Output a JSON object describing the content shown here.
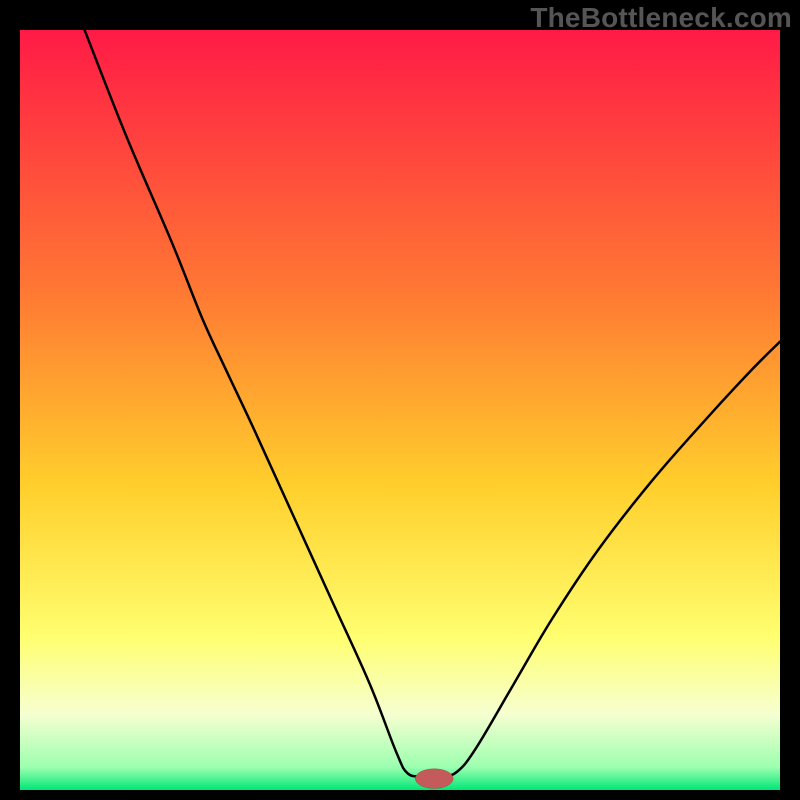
{
  "watermark": "TheBottleneck.com",
  "chart_data": {
    "type": "line",
    "title": "",
    "xlabel": "",
    "ylabel": "",
    "xlim": [
      0,
      100
    ],
    "ylim": [
      0,
      100
    ],
    "background_gradient": {
      "stops": [
        {
          "offset": 0.0,
          "color": "#ff1a46"
        },
        {
          "offset": 0.35,
          "color": "#ff7a33"
        },
        {
          "offset": 0.6,
          "color": "#ffcf2c"
        },
        {
          "offset": 0.8,
          "color": "#ffff70"
        },
        {
          "offset": 0.9,
          "color": "#f6ffd0"
        },
        {
          "offset": 0.97,
          "color": "#9cffb0"
        },
        {
          "offset": 1.0,
          "color": "#00e676"
        }
      ]
    },
    "series": [
      {
        "name": "bottleneck-curve",
        "color": "#000000",
        "width": 2.5,
        "points": [
          {
            "x": 8.5,
            "y": 100.0
          },
          {
            "x": 14.0,
            "y": 86.0
          },
          {
            "x": 20.0,
            "y": 72.0
          },
          {
            "x": 24.0,
            "y": 62.0
          },
          {
            "x": 27.0,
            "y": 55.5
          },
          {
            "x": 31.0,
            "y": 47.0
          },
          {
            "x": 36.0,
            "y": 36.0
          },
          {
            "x": 41.0,
            "y": 25.0
          },
          {
            "x": 46.0,
            "y": 14.0
          },
          {
            "x": 49.5,
            "y": 5.0
          },
          {
            "x": 51.0,
            "y": 2.2
          },
          {
            "x": 53.0,
            "y": 1.8
          },
          {
            "x": 55.5,
            "y": 1.8
          },
          {
            "x": 57.5,
            "y": 2.4
          },
          {
            "x": 60.0,
            "y": 5.5
          },
          {
            "x": 65.0,
            "y": 14.0
          },
          {
            "x": 70.0,
            "y": 22.5
          },
          {
            "x": 76.0,
            "y": 31.5
          },
          {
            "x": 83.0,
            "y": 40.5
          },
          {
            "x": 90.0,
            "y": 48.5
          },
          {
            "x": 96.0,
            "y": 55.0
          },
          {
            "x": 100.0,
            "y": 59.0
          }
        ]
      }
    ],
    "marker": {
      "name": "optimal-point",
      "cx": 54.5,
      "cy": 1.5,
      "rx": 2.5,
      "ry": 1.3,
      "fill": "#c45a5a",
      "stroke": "#8a3b3b"
    }
  }
}
